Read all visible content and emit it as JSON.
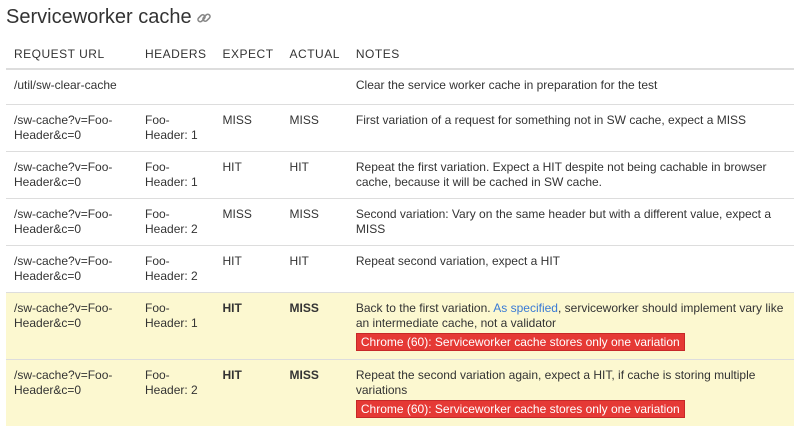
{
  "title": "Serviceworker cache",
  "icons": {
    "title_link": "link-icon"
  },
  "columns": [
    "REQUEST URL",
    "HEADERS",
    "EXPECT",
    "ACTUAL",
    "NOTES"
  ],
  "rows": [
    {
      "url": "/util/sw-clear-cache",
      "headers": "",
      "expect": "",
      "actual": "",
      "notes": "Clear the service worker cache in preparation for the test"
    },
    {
      "url": "/sw-cache?v=Foo-Header&c=0",
      "headers": "Foo-Header: 1",
      "expect": "MISS",
      "actual": "MISS",
      "notes": "First variation of a request for something not in SW cache, expect a MISS"
    },
    {
      "url": "/sw-cache?v=Foo-Header&c=0",
      "headers": "Foo-Header: 1",
      "expect": "HIT",
      "actual": "HIT",
      "notes": "Repeat the first variation. Expect a HIT despite not being cachable in browser cache, because it will be cached in SW cache."
    },
    {
      "url": "/sw-cache?v=Foo-Header&c=0",
      "headers": "Foo-Header: 2",
      "expect": "MISS",
      "actual": "MISS",
      "notes": "Second variation: Vary on the same header but with a different value, expect a MISS"
    },
    {
      "url": "/sw-cache?v=Foo-Header&c=0",
      "headers": "Foo-Header: 2",
      "expect": "HIT",
      "actual": "HIT",
      "notes": "Repeat second variation, expect a HIT"
    },
    {
      "url": "/sw-cache?v=Foo-Header&c=0",
      "headers": "Foo-Header: 1",
      "expect": "HIT",
      "actual": "MISS",
      "notes_before": "Back to the first variation. ",
      "notes_link": "As specified",
      "notes_after": ", serviceworker should implement vary like an intermediate cache, not a validator",
      "badge": "Chrome (60): Serviceworker cache stores only one variation"
    },
    {
      "url": "/sw-cache?v=Foo-Header&c=0",
      "headers": "Foo-Header: 2",
      "expect": "HIT",
      "actual": "MISS",
      "notes": "Repeat the second variation again, expect a HIT, if cache is storing multiple variations",
      "badge": "Chrome (60): Serviceworker cache stores only one variation"
    }
  ],
  "colors": {
    "fail_row_bg": "#fcf8d0",
    "badge_bg": "#e53935",
    "link": "#3a7bd5"
  }
}
